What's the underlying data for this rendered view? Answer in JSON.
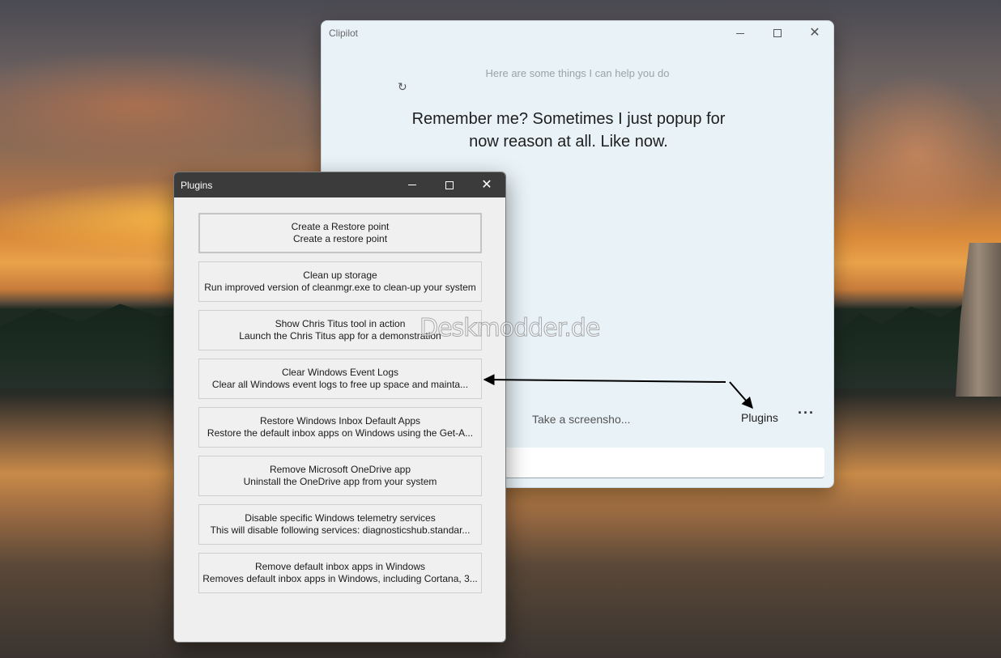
{
  "clipilot": {
    "title": "Clipilot",
    "help_text": "Here are some things I can help you do",
    "message": "Remember me? Sometimes I just popup for now reason at all. Like now.",
    "screenshot_link": "Take a screensho...",
    "plugins_link": "Plugins",
    "more_label": "···"
  },
  "plugins_window": {
    "title": "Plugins",
    "items": [
      {
        "title": "Create a Restore point",
        "desc": "Create a restore point"
      },
      {
        "title": "Clean up storage",
        "desc": "Run improved version of cleanmgr.exe to clean-up your system"
      },
      {
        "title": "Show Chris Titus tool in action",
        "desc": "Launch the Chris Titus app for a demonstration"
      },
      {
        "title": "Clear Windows Event Logs",
        "desc": "Clear all Windows event logs to free up space and mainta..."
      },
      {
        "title": "Restore Windows Inbox Default Apps",
        "desc": "Restore the default inbox apps on Windows using the Get-A..."
      },
      {
        "title": "Remove Microsoft OneDrive app",
        "desc": "Uninstall the OneDrive app from your system"
      },
      {
        "title": "Disable specific Windows telemetry services",
        "desc": "This will disable following services: diagnosticshub.standar..."
      },
      {
        "title": "Remove default inbox apps in Windows",
        "desc": "Removes default inbox apps in Windows, including Cortana, 3..."
      }
    ]
  },
  "watermark": "Deskmodder.de",
  "icons": {
    "minimize": "minimize-icon",
    "maximize": "maximize-icon",
    "close": "close-icon",
    "refresh": "refresh-icon"
  }
}
